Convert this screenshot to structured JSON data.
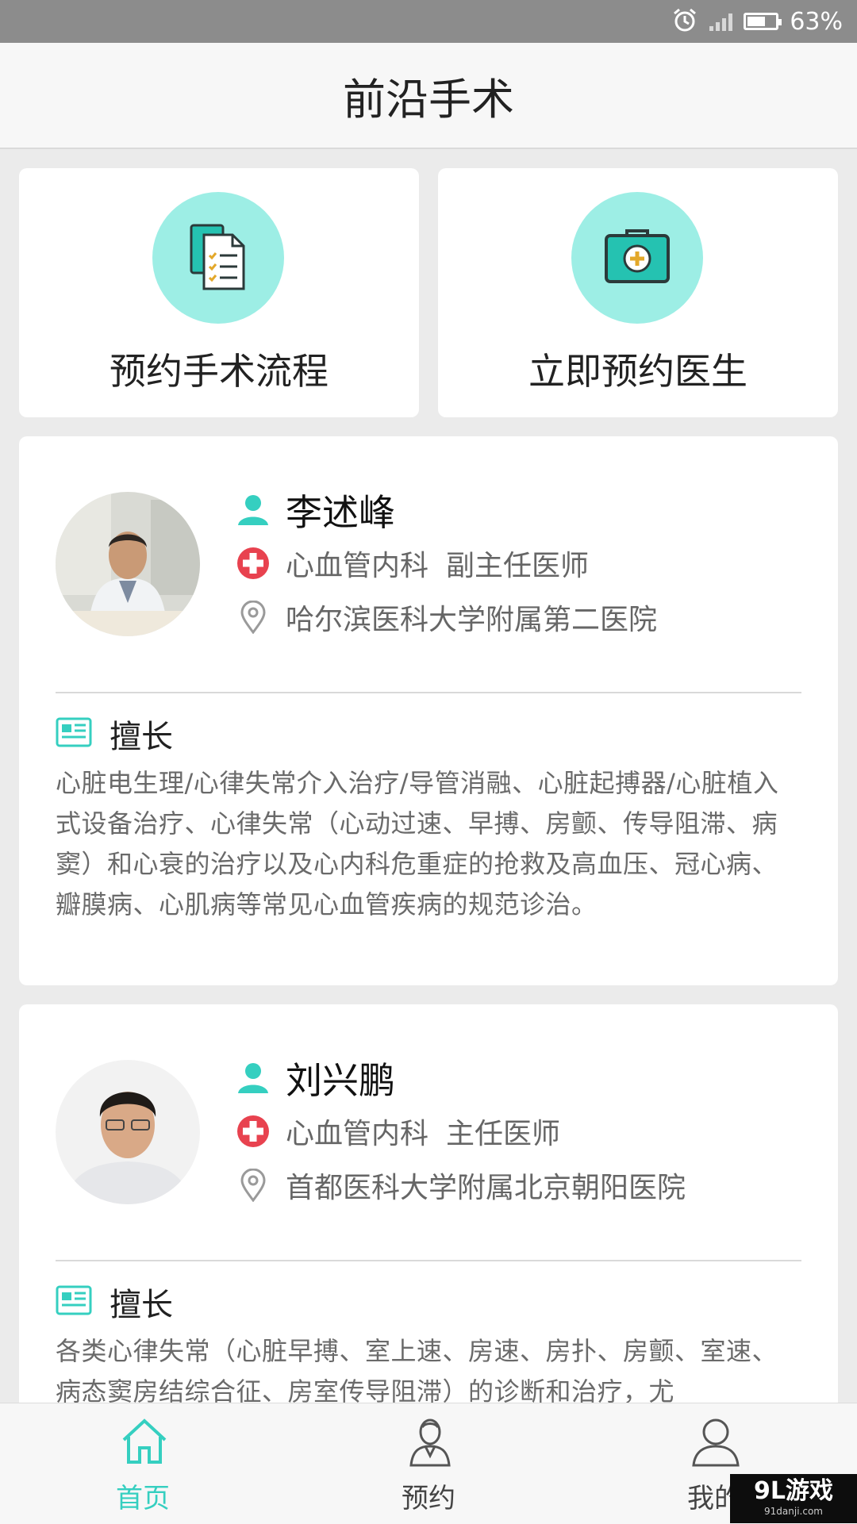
{
  "status_bar": {
    "battery_percent": "63%",
    "battery_level": 0.63,
    "icons": [
      "alarm-icon",
      "signal-icon",
      "battery-icon"
    ]
  },
  "header": {
    "title": "前沿手术"
  },
  "actions": [
    {
      "label": "预约手术流程",
      "icon": "checklist-document-icon"
    },
    {
      "label": "立即预约医生",
      "icon": "medical-kit-icon"
    }
  ],
  "doctors": [
    {
      "name": "李述峰",
      "department": "心血管内科",
      "title": "副主任医师",
      "hospital": "哈尔滨医科大学附属第二医院",
      "specialty_label": "擅长",
      "specialty": "心脏电生理/心律失常介入治疗/导管消融、心脏起搏器/心脏植入式设备治疗、心律失常（心动过速、早搏、房颤、传导阻滞、病窦）和心衰的治疗以及心内科危重症的抢救及高血压、冠心病、瓣膜病、心肌病等常见心血管疾病的规范诊治。"
    },
    {
      "name": "刘兴鹏",
      "department": "心血管内科",
      "title": "主任医师",
      "hospital": "首都医科大学附属北京朝阳医院",
      "specialty_label": "擅长",
      "specialty": "各类心律失常（心脏早搏、室上速、房速、房扑、房颤、室速、病态窦房结综合征、房室传导阻滞）的诊断和治疗，尤"
    }
  ],
  "bottom_nav": [
    {
      "label": "首页",
      "icon": "home-icon",
      "active": true
    },
    {
      "label": "预约",
      "icon": "doctor-icon",
      "active": false
    },
    {
      "label": "我的",
      "icon": "user-icon",
      "active": false
    }
  ],
  "watermark": {
    "main": "9L游戏",
    "sub": "91danji.com"
  },
  "colors": {
    "accent": "#35cfc0",
    "icon_circle": "#9deee5",
    "red_cross": "#e8424f",
    "status_bar": "#8c8c8c"
  }
}
